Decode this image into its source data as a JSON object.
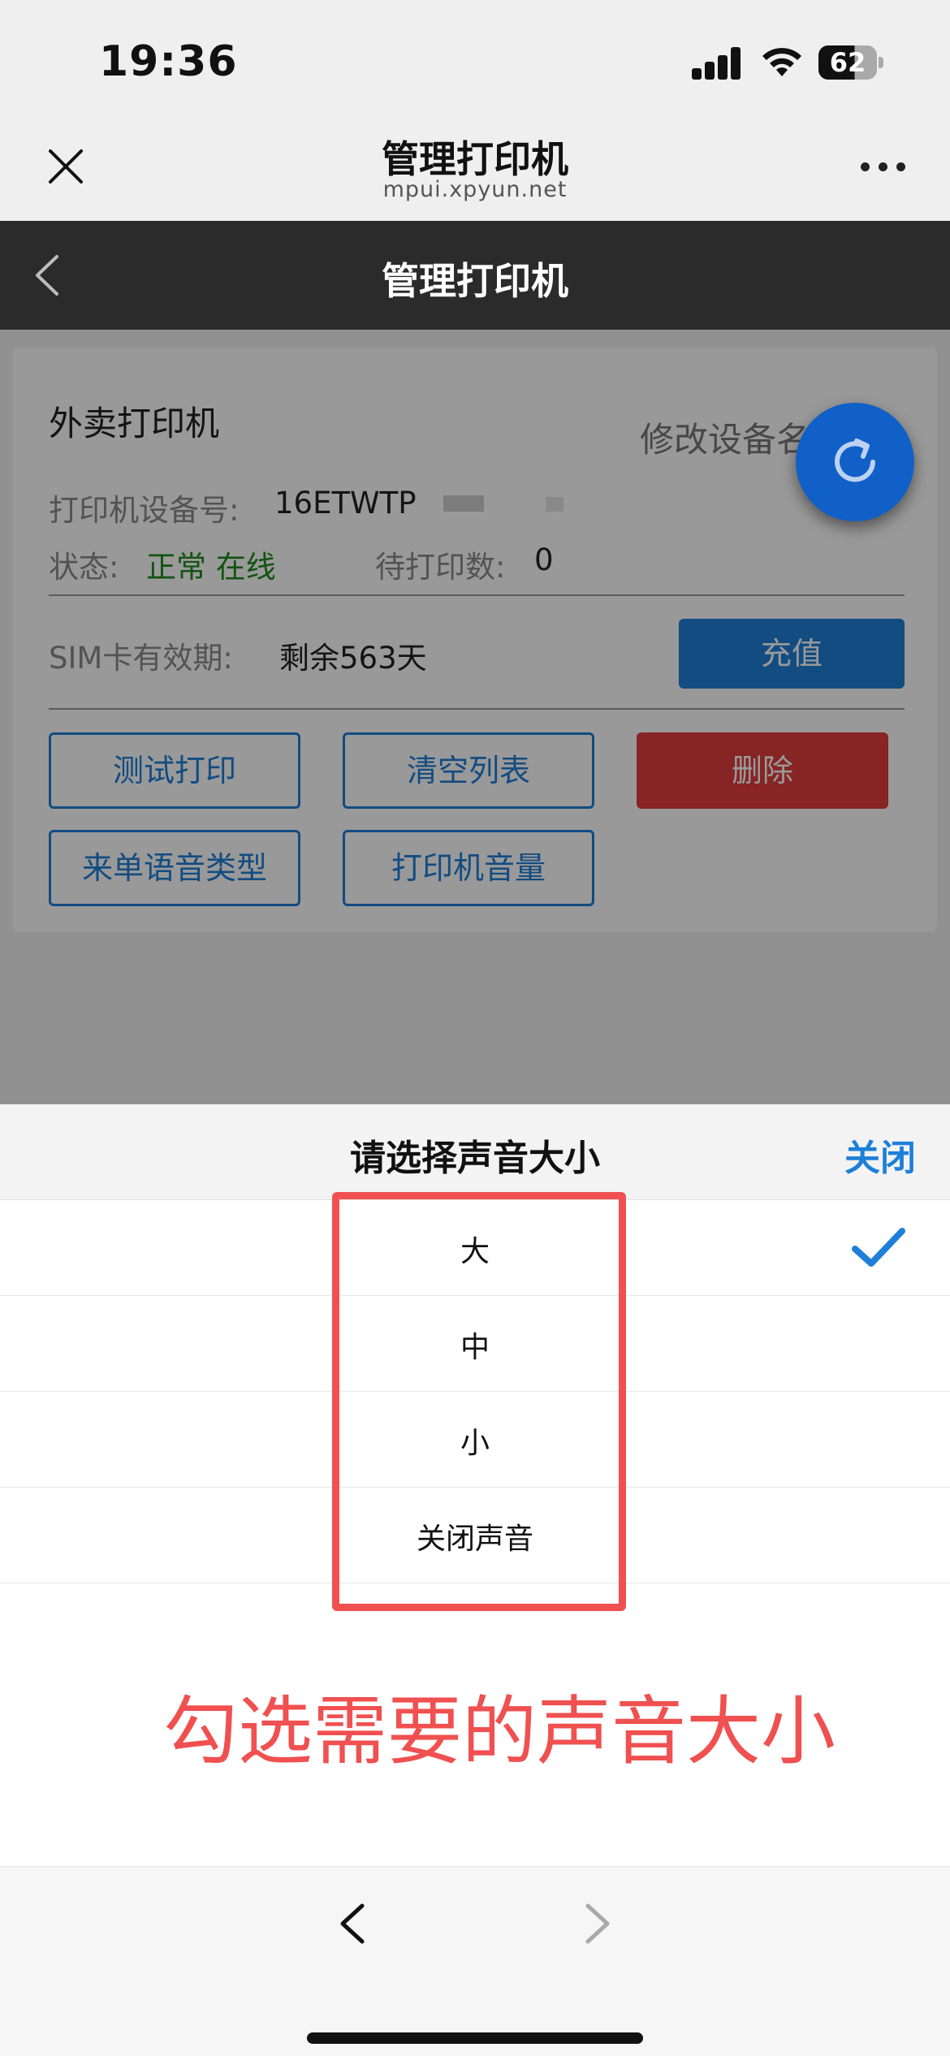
{
  "status_bar": {
    "time": "19:36",
    "battery": "62"
  },
  "browser": {
    "title": "管理打印机",
    "url": "mpui.xpyun.net"
  },
  "app_nav": {
    "title": "管理打印机"
  },
  "card": {
    "device_name": "外卖打印机",
    "rename_link": "修改设备名",
    "serial_label": "打印机设备号:",
    "serial_value": "16ETWTP",
    "status_label": "状态:",
    "status_value": "正常 在线",
    "pending_label": "待打印数:",
    "pending_value": "0",
    "sim_label": "SIM卡有效期:",
    "sim_value": "剩余563天",
    "recharge_button": "充值",
    "buttons": {
      "test_print": "测试打印",
      "clear_list": "清空列表",
      "delete": "删除",
      "voice_type": "来单语音类型",
      "volume": "打印机音量"
    }
  },
  "sheet": {
    "title": "请选择声音大小",
    "close": "关闭",
    "options": [
      "大",
      "中",
      "小",
      "关闭声音"
    ],
    "selected_index": 0
  },
  "annotation": "勾选需要的声音大小",
  "icons": [
    "close-icon",
    "more-icon",
    "back-icon",
    "refresh-icon",
    "check-icon",
    "chevron-left-icon",
    "chevron-right-icon"
  ],
  "colors": {
    "accent": "#1e7fd8",
    "danger": "#e23d3d",
    "status_ok": "#1f8a1f",
    "annotation": "#f05050",
    "nav_bar": "#2b2b2b"
  }
}
